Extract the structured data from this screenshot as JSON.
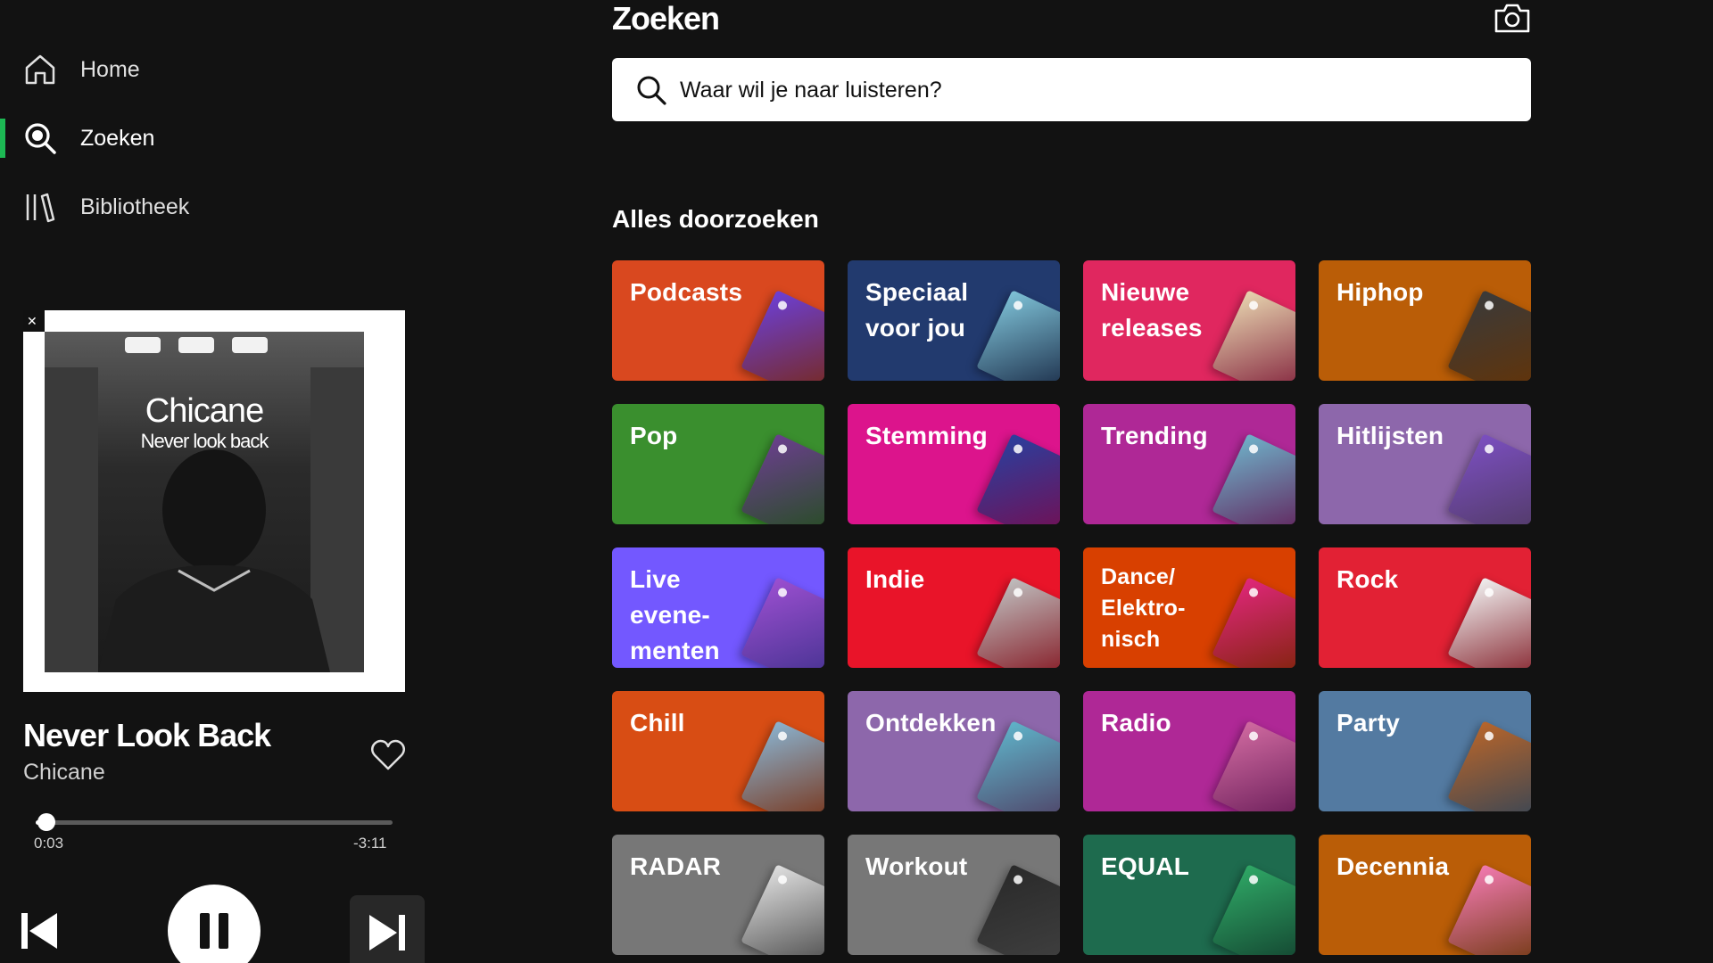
{
  "sidebar": {
    "nav": [
      {
        "label": "Home",
        "icon": "home-icon",
        "active": false
      },
      {
        "label": "Zoeken",
        "icon": "search-icon",
        "active": true
      },
      {
        "label": "Bibliotheek",
        "icon": "library-icon",
        "active": false
      }
    ],
    "album": {
      "title": "Chicane",
      "subtitle": "Never look back"
    },
    "player": {
      "track_title": "Never Look Back",
      "artist": "Chicane",
      "elapsed": "0:03",
      "remaining": "-3:11",
      "progress_fraction": 0.03
    }
  },
  "main": {
    "title": "Zoeken",
    "search": {
      "placeholder": "Waar wil je naar luisteren?"
    },
    "section_title": "Alles doorzoeken",
    "tiles": [
      {
        "label": "Podcasts",
        "color": "#d9481f",
        "art": "#6c3fd6"
      },
      {
        "label": "Speciaal voor jou",
        "color": "#223a6e",
        "art": "#7fc3d8"
      },
      {
        "label": "Nieuwe releases",
        "color": "#e0275f",
        "art": "#e8d6b0"
      },
      {
        "label": "Hiphop",
        "color": "#ba5d07",
        "art": "#3a3a3a"
      },
      {
        "label": "Pop",
        "color": "#3a8f2e",
        "art": "#6b3f8e"
      },
      {
        "label": "Stemming",
        "color": "#dc148c",
        "art": "#2a3f9e"
      },
      {
        "label": "Trending",
        "color": "#af2896",
        "art": "#6fb2c9"
      },
      {
        "label": "Hitlijsten",
        "color": "#8d67ab",
        "art": "#7b4fc0"
      },
      {
        "label": "Live evene-menten",
        "color": "#7358ff",
        "art": "#9b4fd0"
      },
      {
        "label": "Indie",
        "color": "#e91429",
        "art": "#bfbfbf"
      },
      {
        "label": "Dance/ Elektro-nisch",
        "color": "#d84000",
        "art": "#e0277a"
      },
      {
        "label": "Rock",
        "color": "#e22134",
        "art": "#f0f0f0"
      },
      {
        "label": "Chill",
        "color": "#d84d14",
        "art": "#8ab3d0"
      },
      {
        "label": "Ontdekken",
        "color": "#8d67ab",
        "art": "#5fb3c9"
      },
      {
        "label": "Radio",
        "color": "#af2896",
        "art": "#d06aa0"
      },
      {
        "label": "Party",
        "color": "#537aa1",
        "art": "#b8652a"
      },
      {
        "label": "RADAR",
        "color": "#777777",
        "art": "#e0e0e0"
      },
      {
        "label": "Workout",
        "color": "#777777",
        "art": "#2a2a2a"
      },
      {
        "label": "EQUAL",
        "color": "#1e6b4e",
        "art": "#2fa866"
      },
      {
        "label": "Decennia",
        "color": "#ba5d07",
        "art": "#f27ab0"
      }
    ]
  },
  "colors": {
    "accent": "#1db954",
    "background": "#121212"
  }
}
